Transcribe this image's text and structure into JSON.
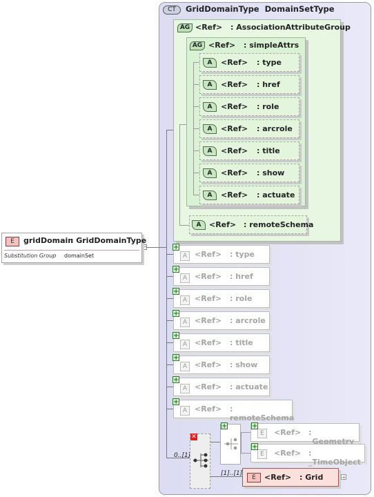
{
  "complex_type": {
    "badge": "CT",
    "name": "GridDomainType",
    "base": "DomainSetType"
  },
  "attribute_group": {
    "badge": "AG",
    "ref": "<Ref>",
    "name": ": AssociationAttributeGroup"
  },
  "inner_group": {
    "badge": "AG",
    "ref": "<Ref>",
    "name": ": simpleAttrs"
  },
  "inner_attributes": [
    {
      "badge": "A",
      "ref": "<Ref>",
      "name": ": type"
    },
    {
      "badge": "A",
      "ref": "<Ref>",
      "name": ": href"
    },
    {
      "badge": "A",
      "ref": "<Ref>",
      "name": ": role"
    },
    {
      "badge": "A",
      "ref": "<Ref>",
      "name": ": arcrole"
    },
    {
      "badge": "A",
      "ref": "<Ref>",
      "name": ": title"
    },
    {
      "badge": "A",
      "ref": "<Ref>",
      "name": ": show"
    },
    {
      "badge": "A",
      "ref": "<Ref>",
      "name": ": actuate"
    }
  ],
  "remote_schema": {
    "badge": "A",
    "ref": "<Ref>",
    "name": ": remoteSchema"
  },
  "root_element": {
    "badge": "E",
    "name": "gridDomain",
    "type": ": GridDomainType",
    "substitution_label": "Substitution Group",
    "substitution_value": "domainSet"
  },
  "collapsed_attributes": [
    {
      "badge": "A",
      "ref": "<Ref>",
      "name": ": type"
    },
    {
      "badge": "A",
      "ref": "<Ref>",
      "name": ": href"
    },
    {
      "badge": "A",
      "ref": "<Ref>",
      "name": ": role"
    },
    {
      "badge": "A",
      "ref": "<Ref>",
      "name": ": arcrole"
    },
    {
      "badge": "A",
      "ref": "<Ref>",
      "name": ": title"
    },
    {
      "badge": "A",
      "ref": "<Ref>",
      "name": ": show"
    },
    {
      "badge": "A",
      "ref": "<Ref>",
      "name": ": actuate"
    },
    {
      "badge": "A",
      "ref": "<Ref>",
      "name": ": remoteSchema"
    }
  ],
  "choice_options": [
    {
      "badge": "E",
      "ref": "<Ref>",
      "name": ": _Geometry"
    },
    {
      "badge": "E",
      "ref": "<Ref>",
      "name": ": _TimeObject"
    }
  ],
  "grid_element": {
    "badge": "E",
    "ref": "<Ref>",
    "name": ": Grid"
  },
  "occurrences": {
    "choice": "0..[1]",
    "grid": "[1]..[1]"
  },
  "colors": {
    "element_fill": "#fbe0dc",
    "group_fill": "#e7f7e1",
    "type_fill": "#e4e4f6"
  }
}
